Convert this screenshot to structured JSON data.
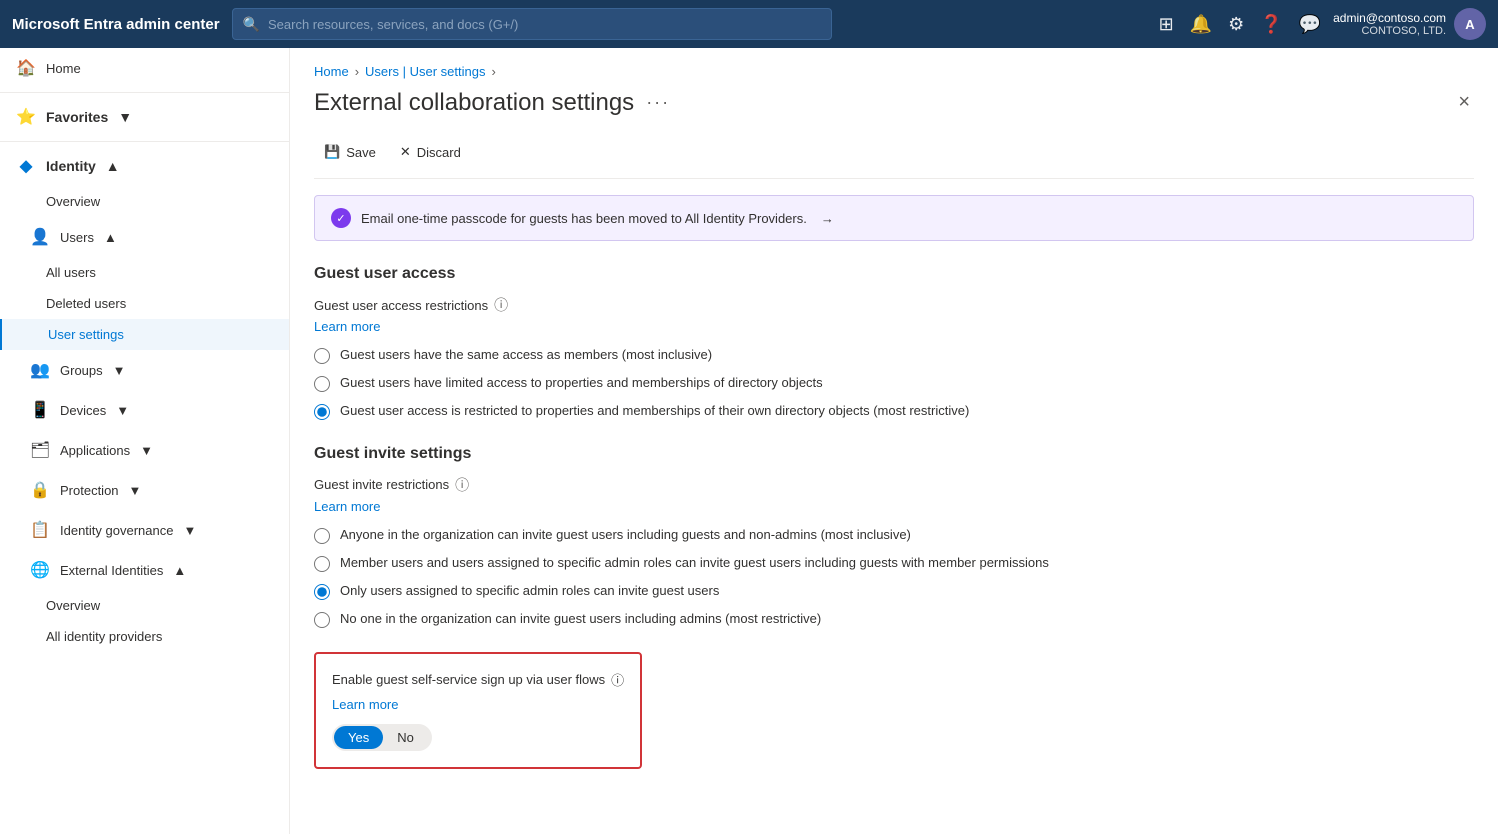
{
  "brand": "Microsoft Entra admin center",
  "search": {
    "placeholder": "Search resources, services, and docs (G+/)"
  },
  "user": {
    "email": "admin@contoso.com",
    "org": "CONTOSO, LTD.",
    "initials": "A"
  },
  "sidebar": {
    "home": "Home",
    "favorites": "Favorites",
    "identity": "Identity",
    "overview": "Overview",
    "users": "Users",
    "all_users": "All users",
    "deleted_users": "Deleted users",
    "user_settings": "User settings",
    "groups": "Groups",
    "devices": "Devices",
    "applications": "Applications",
    "protection": "Protection",
    "identity_governance": "Identity governance",
    "external_identities": "External Identities",
    "ext_overview": "Overview",
    "all_identity_providers": "All identity providers"
  },
  "breadcrumb": {
    "home": "Home",
    "users_settings": "Users | User settings"
  },
  "page": {
    "title": "External collaboration settings",
    "close_label": "×",
    "more_options": "···"
  },
  "toolbar": {
    "save": "Save",
    "discard": "Discard"
  },
  "banner": {
    "message": "Email one-time passcode for guests has been moved to All Identity Providers.",
    "arrow": "→"
  },
  "guest_access": {
    "section_title": "Guest user access",
    "field_label": "Guest user access restrictions",
    "learn_more": "Learn more",
    "options": [
      "Guest users have the same access as members (most inclusive)",
      "Guest users have limited access to properties and memberships of directory objects",
      "Guest user access is restricted to properties and memberships of their own directory objects (most restrictive)"
    ],
    "selected_index": 2
  },
  "guest_invite": {
    "section_title": "Guest invite settings",
    "field_label": "Guest invite restrictions",
    "learn_more": "Learn more",
    "options": [
      "Anyone in the organization can invite guest users including guests and non-admins (most inclusive)",
      "Member users and users assigned to specific admin roles can invite guest users including guests with member permissions",
      "Only users assigned to specific admin roles can invite guest users",
      "No one in the organization can invite guest users including admins (most restrictive)"
    ],
    "selected_index": 2
  },
  "self_service": {
    "label": "Enable guest self-service sign up via user flows",
    "learn_more": "Learn more",
    "yes_label": "Yes",
    "no_label": "No",
    "selected": "yes"
  }
}
